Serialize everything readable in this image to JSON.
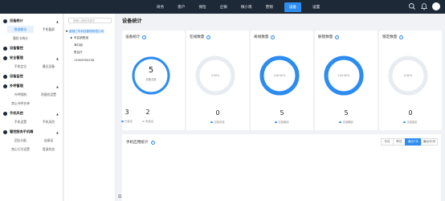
{
  "topnav": {
    "items": [
      {
        "label": "商务",
        "active": false
      },
      {
        "label": "客户",
        "active": false
      },
      {
        "label": "保险",
        "active": false
      },
      {
        "label": "企微",
        "active": false
      },
      {
        "label": "微小南",
        "active": false
      },
      {
        "label": "营销",
        "active": false
      },
      {
        "label": "设备",
        "active": true
      },
      {
        "label": "设置",
        "active": false
      }
    ],
    "icons": [
      "search-icon",
      "bell-icon",
      "avatar"
    ]
  },
  "sidebar": {
    "groups": [
      {
        "label": "设备统计",
        "arrow": "▲",
        "items": [
          {
            "label": "数据概览",
            "active": true
          },
          {
            "label": "手机截屏",
            "active": false
          },
          {
            "label": "骚扰卡统计",
            "active": false
          }
        ]
      },
      {
        "label": "设备管控",
        "arrow": "",
        "items": []
      },
      {
        "label": "安全管理",
        "arrow": "▲",
        "items": [
          {
            "label": "手机定位",
            "active": false
          },
          {
            "label": "最近设备",
            "active": false
          }
        ]
      },
      {
        "label": "设备监控",
        "arrow": "",
        "items": []
      },
      {
        "label": "外呼管理",
        "arrow": "▲",
        "items": [
          {
            "label": "外呼限制",
            "active": false
          },
          {
            "label": "防骚扰设置",
            "active": false
          },
          {
            "label": "禁止外呼名单",
            "active": false
          }
        ]
      },
      {
        "label": "手机风控",
        "arrow": "▲",
        "items": [
          {
            "label": "手机设置",
            "active": false
          },
          {
            "label": "手机风险",
            "active": false
          }
        ]
      },
      {
        "label": "管控服务手机端",
        "arrow": "▲",
        "items": [
          {
            "label": "团队分配",
            "active": false
          },
          {
            "label": "连接设",
            "active": false
          },
          {
            "label": "禁止行为设置",
            "active": false
          },
          {
            "label": "登录状态",
            "active": false
          }
        ]
      }
    ]
  },
  "tree": {
    "search_placeholder": "请输入搜索关键字",
    "root": "营销三号科技管理有限公司",
    "nodes": [
      "市区销售组",
      "海口组",
      "售后行",
      "13309990258"
    ]
  },
  "main": {
    "title": "设备统计"
  },
  "cards": [
    {
      "title": "设备统计",
      "value": "5",
      "center_sub": "设备总数",
      "percent": 1.0,
      "center_text": "",
      "bottom": [
        {
          "num": "3",
          "label": "已激活",
          "dot": "#2d8cf0"
        },
        {
          "num": "2",
          "label": "未激活",
          "dot": "#c5cbd3"
        }
      ]
    },
    {
      "title": "在线数量",
      "value": "0",
      "center_text": "0.00%",
      "percent": 0,
      "bottom_label": "当前在线",
      "dot": "#2d8cf0"
    },
    {
      "title": "离线数量",
      "value": "5",
      "center_text": "100.00%",
      "percent": 1.0,
      "bottom_label": "当前离线",
      "dot": "#2d8cf0"
    },
    {
      "title": "解锁数量",
      "value": "5",
      "center_text": "100.00%",
      "percent": 1.0,
      "bottom_label": "当前解锁",
      "dot": "#2d8cf0"
    },
    {
      "title": "锁定数量",
      "value": "0",
      "center_text": "0.00%",
      "percent": 0,
      "bottom_label": "当前锁定",
      "dot": "#2d8cf0"
    }
  ],
  "panel": {
    "title": "手机应用统计",
    "buttons": [
      {
        "label": "今日",
        "active": false
      },
      {
        "label": "昨日",
        "active": false
      },
      {
        "label": "最近7天",
        "active": true
      },
      {
        "label": "最近30天",
        "active": false
      }
    ]
  },
  "colors": {
    "accent": "#2d8cf0",
    "ring_bg": "#e8ecf1",
    "topbar": "#1e2937"
  }
}
